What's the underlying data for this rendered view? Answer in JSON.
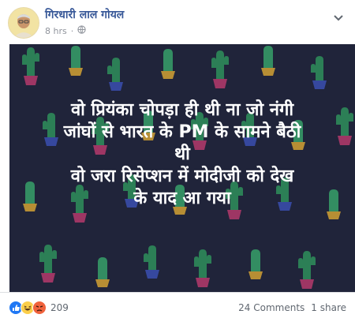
{
  "post": {
    "author": "गिरधारी लाल गोयल",
    "time": "8 hrs",
    "separator": "·",
    "privacy_icon": "globe-icon",
    "options_icon": "chevron-down-icon"
  },
  "image": {
    "lines": [
      "वो प्रियंका चोपड़ा ही थी ना जो नंगी",
      "जांघों से भारत के PM के सामने बैठी",
      "थी",
      "वो जरा रिसेप्शन में मोदीजी को देख",
      "के याद आ गया"
    ],
    "background_color": "#20243a",
    "text_color": "#ffffff"
  },
  "footer": {
    "reactions": [
      "like",
      "haha",
      "angry"
    ],
    "reaction_count": "209",
    "comments": "24 Comments",
    "shares": "1 share"
  },
  "colors": {
    "author_link": "#385898",
    "meta_gray": "#90949c",
    "like_blue": "#2078f4",
    "haha_yellow": "#fbce4a",
    "angry_orange": "#f0623c"
  }
}
